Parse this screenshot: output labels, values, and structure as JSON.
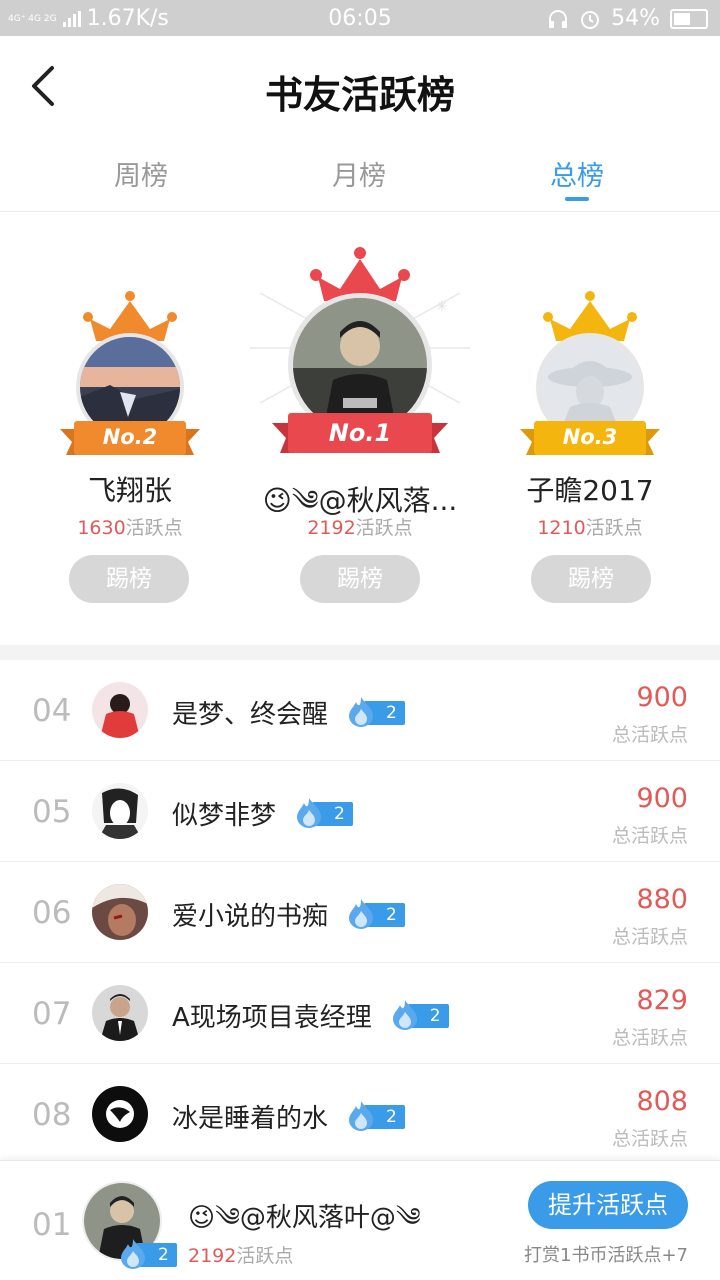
{
  "status_bar": {
    "network": "4G⁺ 4G 2G",
    "speed": "1.67K/s",
    "time": "06:05",
    "battery": "54%"
  },
  "header": {
    "title": "书友活跃榜"
  },
  "tabs": [
    {
      "label": "周榜",
      "active": false
    },
    {
      "label": "月榜",
      "active": false
    },
    {
      "label": "总榜",
      "active": true
    }
  ],
  "podium": {
    "kick_label": "踢榜",
    "score_suffix": "活跃点",
    "first": {
      "badge": "No.1",
      "name": "😉༄@秋风落...",
      "score": "2192"
    },
    "second": {
      "badge": "No.2",
      "name": "飞翔张",
      "score": "1630"
    },
    "third": {
      "badge": "No.3",
      "name": "子瞻2017",
      "score": "1210"
    }
  },
  "list": {
    "score_label": "总活跃点",
    "rows": [
      {
        "rank": "04",
        "name": "是梦、终会醒",
        "level": "2",
        "score": "900"
      },
      {
        "rank": "05",
        "name": "似梦非梦",
        "level": "2",
        "score": "900"
      },
      {
        "rank": "06",
        "name": "爱小说的书痴",
        "level": "2",
        "score": "880"
      },
      {
        "rank": "07",
        "name": "A现场项目袁经理",
        "level": "2",
        "score": "829"
      },
      {
        "rank": "08",
        "name": "冰是睡着的水",
        "level": "2",
        "score": "808"
      }
    ]
  },
  "my_rank": {
    "rank": "01",
    "name": "😉༄@秋风落叶@༄",
    "level": "2",
    "score": "2192",
    "score_suffix": "活跃点",
    "button_label": "提升活跃点",
    "tip": "打赏1书币活跃点+7"
  },
  "colors": {
    "accent": "#3a9be8",
    "score": "#e15a57",
    "gold": "#f5a623",
    "orange": "#f08a2c",
    "red": "#e9494e"
  }
}
